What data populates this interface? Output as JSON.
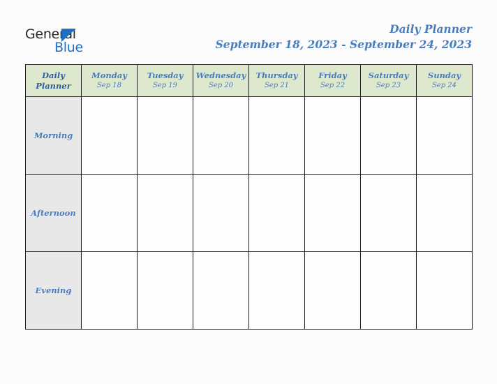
{
  "brand": {
    "logo_word_1": "General",
    "logo_word_2": "Blue",
    "triangle_icon": "triangle-icon",
    "logo_primary_color": "#1f6fc4",
    "logo_text_color": "#262626"
  },
  "header": {
    "title": "Daily Planner",
    "date_range": "September 18, 2023 - September 24, 2023",
    "accent_color": "#4a7ebb"
  },
  "table": {
    "corner_label_line1": "Daily",
    "corner_label_line2": "Planner",
    "header_background": "#dde8cd",
    "row_label_background": "#e8e8e8",
    "cell_background": "#fdfdfd",
    "border_color": "#1a1a1a",
    "columns": [
      {
        "day": "Monday",
        "date": "Sep 18"
      },
      {
        "day": "Tuesday",
        "date": "Sep 19"
      },
      {
        "day": "Wednesday",
        "date": "Sep 20"
      },
      {
        "day": "Thursday",
        "date": "Sep 21"
      },
      {
        "day": "Friday",
        "date": "Sep 22"
      },
      {
        "day": "Saturday",
        "date": "Sep 23"
      },
      {
        "day": "Sunday",
        "date": "Sep 24"
      }
    ],
    "rows": [
      {
        "label": "Morning",
        "entries": [
          "",
          "",
          "",
          "",
          "",
          "",
          ""
        ]
      },
      {
        "label": "Afternoon",
        "entries": [
          "",
          "",
          "",
          "",
          "",
          "",
          ""
        ]
      },
      {
        "label": "Evening",
        "entries": [
          "",
          "",
          "",
          "",
          "",
          "",
          ""
        ]
      }
    ]
  }
}
